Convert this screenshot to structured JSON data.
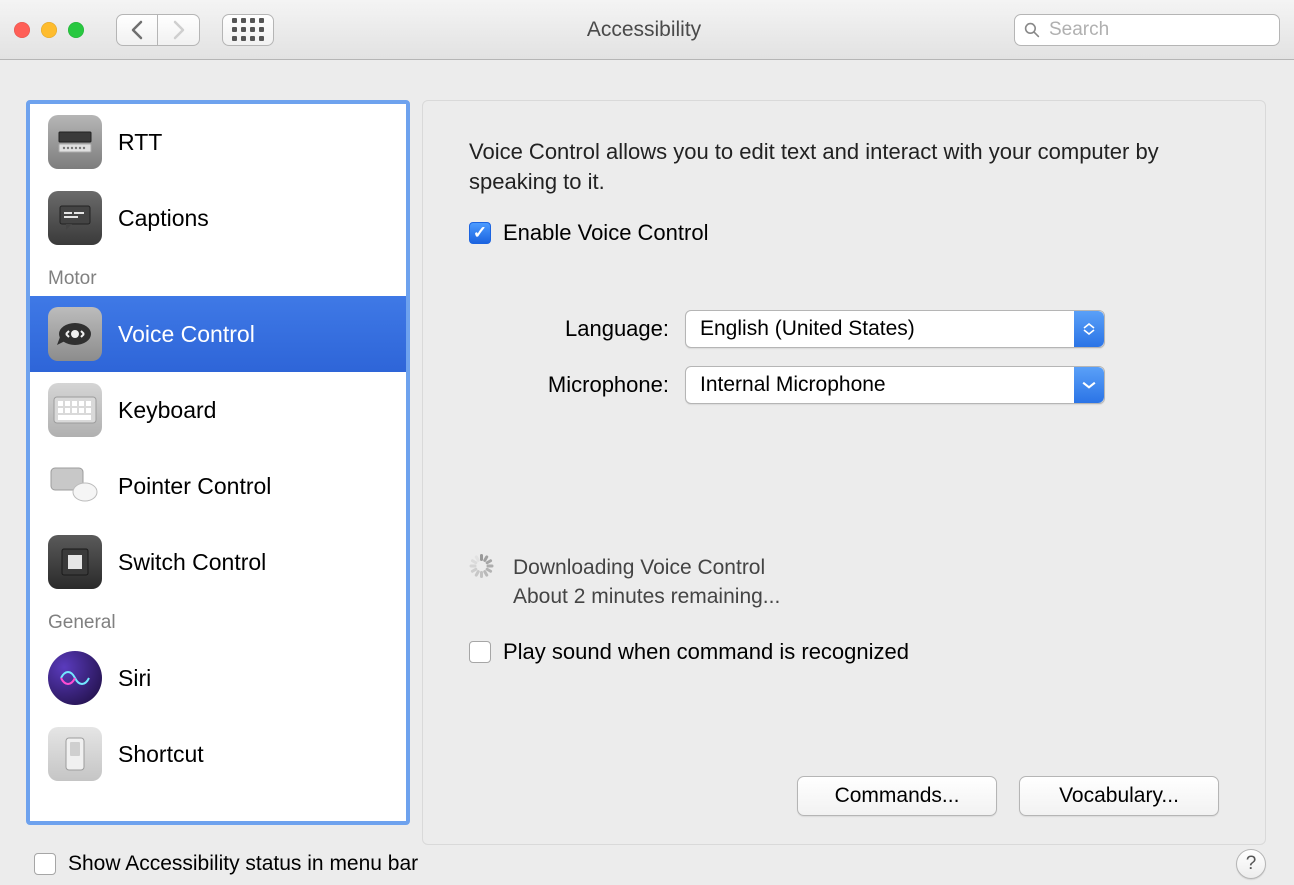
{
  "window": {
    "title": "Accessibility"
  },
  "search": {
    "placeholder": "Search"
  },
  "sidebar": {
    "groups": [
      {
        "label": "Motor"
      },
      {
        "label": "General"
      }
    ],
    "items": [
      {
        "id": "rtt",
        "label": "RTT"
      },
      {
        "id": "captions",
        "label": "Captions"
      },
      {
        "id": "voice-control",
        "label": "Voice Control",
        "selected": true
      },
      {
        "id": "keyboard",
        "label": "Keyboard"
      },
      {
        "id": "pointer",
        "label": "Pointer Control"
      },
      {
        "id": "switch",
        "label": "Switch Control"
      },
      {
        "id": "siri",
        "label": "Siri"
      },
      {
        "id": "shortcut",
        "label": "Shortcut"
      }
    ]
  },
  "panel": {
    "description": "Voice Control allows you to edit text and interact with your computer by speaking to it.",
    "enable_label": "Enable Voice Control",
    "enable_checked": true,
    "language_label": "Language:",
    "language_value": "English (United States)",
    "microphone_label": "Microphone:",
    "microphone_value": "Internal Microphone",
    "status_line1": "Downloading Voice Control",
    "status_line2": "About 2 minutes remaining...",
    "play_sound_label": "Play sound when command is recognized",
    "play_sound_checked": false,
    "commands_button": "Commands...",
    "vocabulary_button": "Vocabulary..."
  },
  "footer": {
    "show_status_label": "Show Accessibility status in menu bar",
    "show_status_checked": false,
    "help": "?"
  }
}
